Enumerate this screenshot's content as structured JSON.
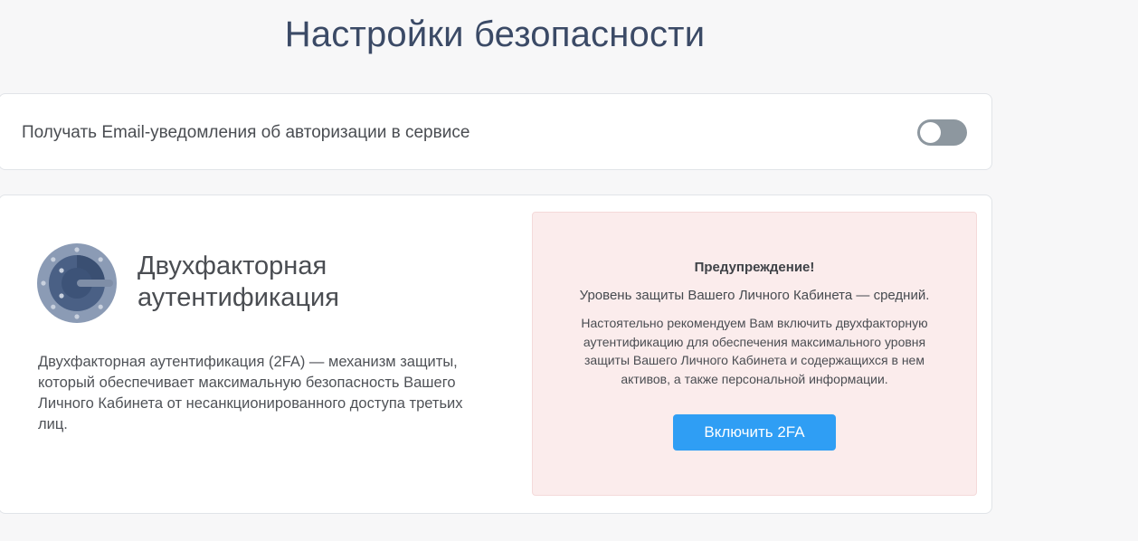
{
  "page": {
    "title": "Настройки безопасности"
  },
  "notifications": {
    "label": "Получать Email-уведомления об авторизации в сервисе",
    "toggle_on": false
  },
  "twofa": {
    "title": "Двухфакторная аутентификация",
    "description": "Двухфакторная аутентификация (2FA) — механизм защиты, который обеспечивает максимальную безопасность Вашего Личного Кабинета от несанкционированного доступа третьих лиц.",
    "logo_icon": "google-authenticator-icon"
  },
  "warning": {
    "heading": "Предупреждение!",
    "level_text": "Уровень защиты Вашего Личного Кабинета — средний.",
    "recommendation": "Настоятельно рекомендуем Вам включить двухфакторную аутентификацию для обеспечения максимального уровня защиты Вашего Личного Кабинета и содержащихся в нем активов, а также персональной информации.",
    "button_label": "Включить 2FA"
  },
  "colors": {
    "title": "#3b4a66",
    "toggle_off": "#8d979f",
    "warning_bg": "#fbecec",
    "button": "#2f9ef4"
  }
}
